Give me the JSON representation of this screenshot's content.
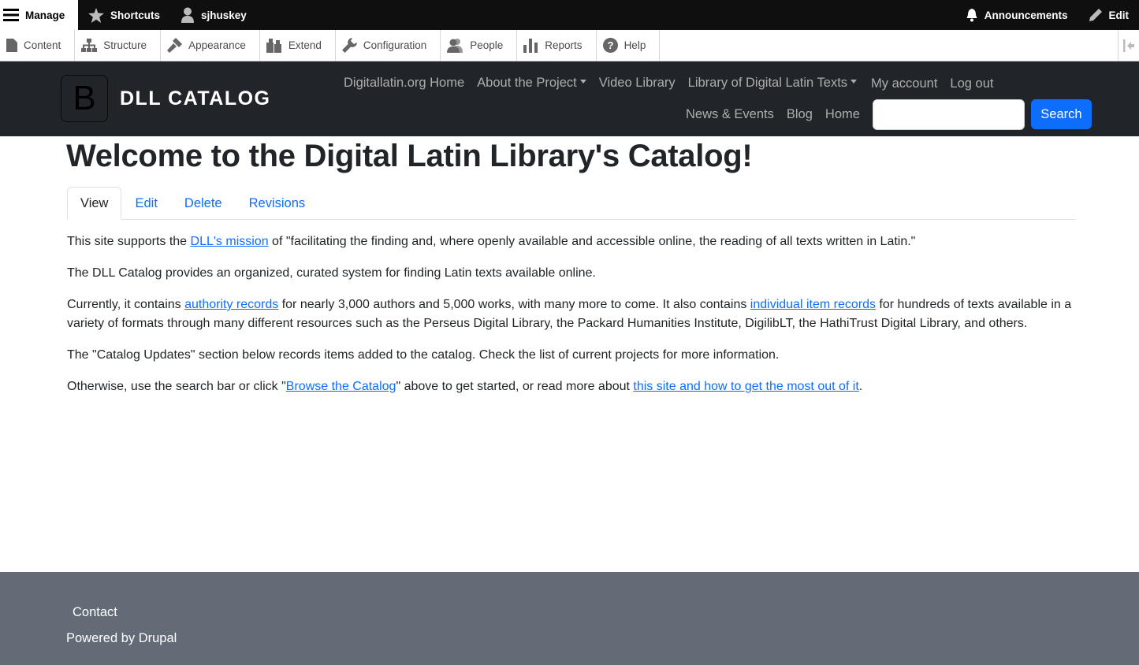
{
  "admin_bar": {
    "manage": "Manage",
    "shortcuts": "Shortcuts",
    "user": "sjhuskey",
    "announcements": "Announcements",
    "edit": "Edit"
  },
  "tray": {
    "items": [
      {
        "label": "Content",
        "icon": "content-icon"
      },
      {
        "label": "Structure",
        "icon": "structure-icon"
      },
      {
        "label": "Appearance",
        "icon": "appearance-icon"
      },
      {
        "label": "Extend",
        "icon": "extend-icon"
      },
      {
        "label": "Configuration",
        "icon": "wrench-icon"
      },
      {
        "label": "People",
        "icon": "people-icon"
      },
      {
        "label": "Reports",
        "icon": "reports-icon"
      },
      {
        "label": "Help",
        "icon": "help-icon"
      }
    ]
  },
  "header": {
    "logo_letter": "B",
    "site_name": "DLL CATALOG",
    "nav_row1": [
      "Digitallatin.org Home",
      "About the Project",
      "Video Library",
      "Library of Digital Latin Texts",
      "My account",
      "Log out"
    ],
    "nav_row2": [
      "News & Events",
      "Blog",
      "Home"
    ],
    "search_button": "Search",
    "search_value": ""
  },
  "main": {
    "title": "Welcome to the Digital Latin Library's Catalog!",
    "tabs": [
      "View",
      "Edit",
      "Delete",
      "Revisions"
    ],
    "p1_pre": "This site supports the ",
    "p1_link": "DLL's mission",
    "p1_post": " of \"facilitating the finding and, where openly available and accessible online, the reading of all texts written in Latin.\"",
    "p2": "The DLL Catalog provides an organized, curated system for finding Latin texts available online.",
    "p3_pre": "Currently, it contains ",
    "p3_link1": "authority records",
    "p3_mid": " for nearly 3,000 authors and 5,000 works, with many more to come. It also contains ",
    "p3_link2": "individual item records",
    "p3_post": " for hundreds of texts available in a variety of formats through many different resources such as the Perseus Digital Library, the Packard Humanities Institute, DigilibLT, the HathiTrust Digital Library, and others.",
    "p4": "The \"Catalog Updates\" section below records items added to the catalog. Check the list of current projects for more information.",
    "p5_pre": "Otherwise, use the search bar or click \"",
    "p5_link1": "Browse the Catalog",
    "p5_mid": "\" above to get started, or read more about ",
    "p5_link2": "this site and how to get the most out of it",
    "p5_post": "."
  },
  "footer": {
    "contact": "Contact",
    "powered": "Powered by Drupal"
  },
  "colors": {
    "admin_bar": "#0f0f0f",
    "site_header": "#212529",
    "link": "#0d6efd",
    "footer": "#636b76"
  }
}
